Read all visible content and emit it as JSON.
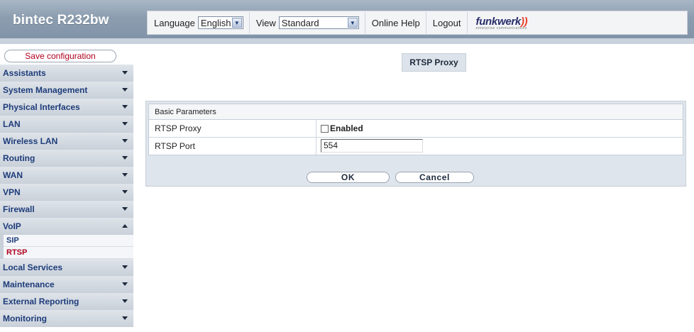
{
  "header": {
    "brand": "bintec R232bw",
    "language_label": "Language",
    "language_value": "English",
    "view_label": "View",
    "view_value": "Standard",
    "online_help": "Online Help",
    "logout": "Logout",
    "logo_text": "funkwerk",
    "logo_mark": "))",
    "logo_subtext": "enterprise communications"
  },
  "sidebar": {
    "save_configuration": "Save configuration",
    "items": [
      {
        "label": "Assistants"
      },
      {
        "label": "System Management"
      },
      {
        "label": "Physical Interfaces"
      },
      {
        "label": "LAN"
      },
      {
        "label": "Wireless LAN"
      },
      {
        "label": "Routing"
      },
      {
        "label": "WAN"
      },
      {
        "label": "VPN"
      },
      {
        "label": "Firewall"
      },
      {
        "label": "VoIP"
      },
      {
        "label": "Local Services"
      },
      {
        "label": "Maintenance"
      },
      {
        "label": "External Reporting"
      },
      {
        "label": "Monitoring"
      }
    ],
    "voip_sub": [
      {
        "label": "SIP"
      },
      {
        "label": "RTSP"
      }
    ]
  },
  "main": {
    "page_title": "RTSP Proxy",
    "section_title": "Basic Parameters",
    "rtsp_proxy_label": "RTSP Proxy",
    "rtsp_proxy_checkbox_label": "Enabled",
    "rtsp_proxy_enabled": false,
    "rtsp_port_label": "RTSP Port",
    "rtsp_port_value": "554",
    "ok_button": "OK",
    "cancel_button": "Cancel"
  },
  "colors": {
    "menu_text": "#1d3c7a",
    "active_red": "#b0001e",
    "header_bg": "#8c9db0"
  }
}
